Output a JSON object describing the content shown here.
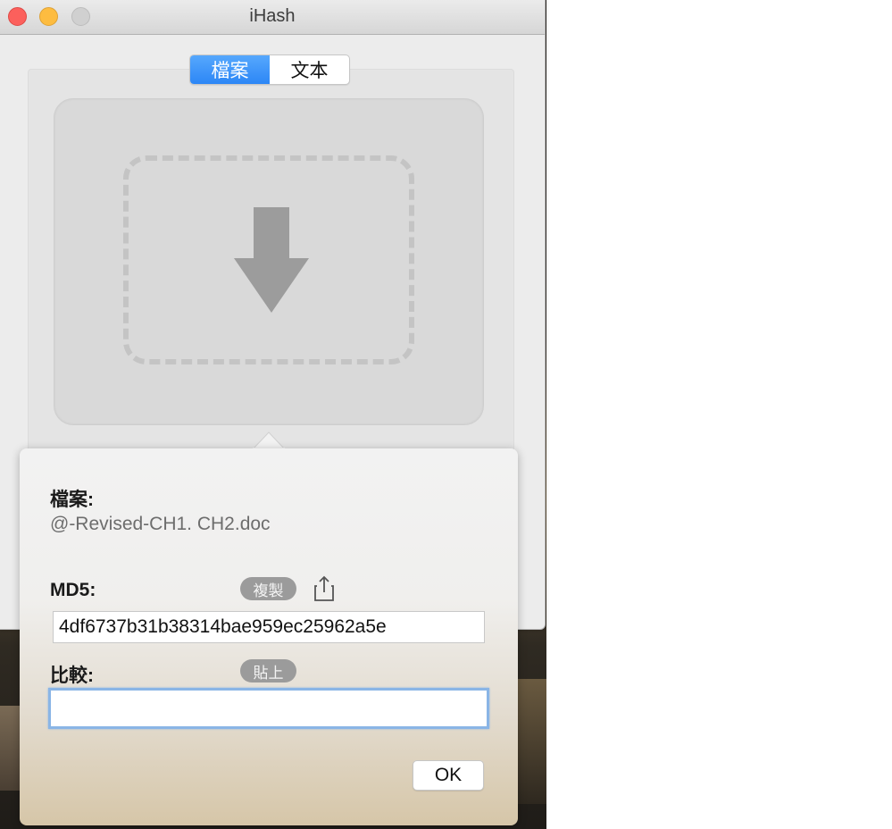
{
  "window": {
    "title": "iHash"
  },
  "mode_tabs": [
    {
      "label": "檔案",
      "selected": true
    },
    {
      "label": "文本",
      "selected": false
    }
  ],
  "drop_zone": {
    "icon": "download-arrow-icon"
  },
  "result": {
    "file_label": "檔案:",
    "file_name": "@-Revised-CH1. CH2.doc",
    "md5_label": "MD5:",
    "copy_label": "複製",
    "share_icon": "share-icon",
    "md5_value": "4df6737b31b38314bae959ec25962a5e",
    "compare_label": "比較:",
    "paste_label": "貼上",
    "compare_value": "",
    "ok_label": "OK"
  },
  "colors": {
    "accent": "#2c86f6",
    "focus_ring": "#8ab5e6",
    "close": "#fc605c",
    "minimize": "#fdbc40"
  }
}
